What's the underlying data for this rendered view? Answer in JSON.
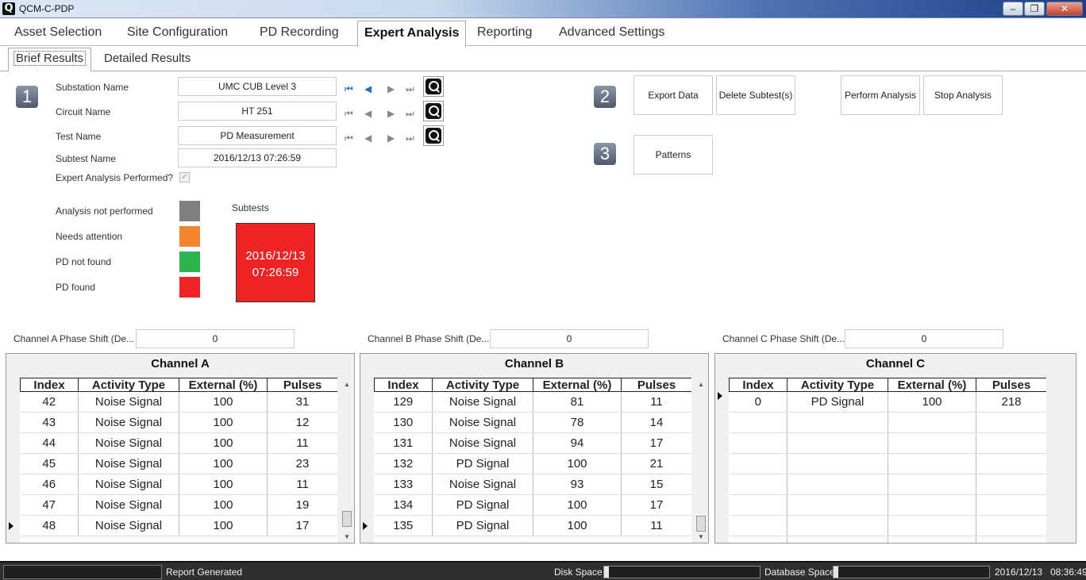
{
  "window": {
    "title": "QCM-C-PDP",
    "minimize": "‒",
    "maximize": "❐",
    "close": "✕"
  },
  "main_tabs": [
    "Asset Selection",
    "Site Configuration",
    "PD Recording",
    "Expert Analysis",
    "Reporting",
    "Advanced Settings"
  ],
  "active_main_tab": "Expert Analysis",
  "sub_tabs": [
    "Brief Results",
    "Detailed Results"
  ],
  "steps": [
    "1",
    "2",
    "3"
  ],
  "form": {
    "substation_label": "Substation Name",
    "substation_value": "UMC CUB Level 3",
    "circuit_label": "Circuit Name",
    "circuit_value": "HT 251",
    "test_label": "Test Name",
    "test_value": "PD Measurement",
    "subtest_label": "Subtest Name",
    "subtest_value": "2016/12/13 07:26:59",
    "expert_label": "Expert Analysis Performed?",
    "expert_checked": "✓"
  },
  "buttons": {
    "export": "Export Data",
    "delete": "Delete Subtest(s)",
    "perform": "Perform Analysis",
    "stop": "Stop Analysis",
    "patterns": "Patterns"
  },
  "legend": [
    {
      "label": "Analysis not performed",
      "color": "#808080"
    },
    {
      "label": "Needs attention",
      "color": "#f28430"
    },
    {
      "label": "PD not found",
      "color": "#2db350"
    },
    {
      "label": "PD found",
      "color": "#ee2326"
    }
  ],
  "subtests": {
    "title": "Subtests",
    "date": "2016/12/13",
    "time": "07:26:59",
    "color": "#ee2326"
  },
  "phase_shift": {
    "a_label": "Channel A Phase Shift (De...",
    "a_value": "0",
    "b_label": "Channel B Phase Shift (De...",
    "b_value": "0",
    "c_label": "Channel C Phase Shift (De...",
    "c_value": "0"
  },
  "columns": [
    "Index",
    "Activity Type",
    "External (%)",
    "Pulses"
  ],
  "channels": {
    "a": {
      "title": "Channel A",
      "rows": [
        [
          "42",
          "Noise Signal",
          "100",
          "31"
        ],
        [
          "43",
          "Noise Signal",
          "100",
          "12"
        ],
        [
          "44",
          "Noise Signal",
          "100",
          "11"
        ],
        [
          "45",
          "Noise Signal",
          "100",
          "23"
        ],
        [
          "46",
          "Noise Signal",
          "100",
          "11"
        ],
        [
          "47",
          "Noise Signal",
          "100",
          "19"
        ],
        [
          "48",
          "Noise Signal",
          "100",
          "17"
        ]
      ]
    },
    "b": {
      "title": "Channel B",
      "rows": [
        [
          "129",
          "Noise Signal",
          "81",
          "11"
        ],
        [
          "130",
          "Noise Signal",
          "78",
          "14"
        ],
        [
          "131",
          "Noise Signal",
          "94",
          "17"
        ],
        [
          "132",
          "PD Signal",
          "100",
          "21"
        ],
        [
          "133",
          "Noise Signal",
          "93",
          "15"
        ],
        [
          "134",
          "PD Signal",
          "100",
          "17"
        ],
        [
          "135",
          "PD Signal",
          "100",
          "11"
        ]
      ]
    },
    "c": {
      "title": "Channel C",
      "rows": [
        [
          "0",
          "PD Signal",
          "100",
          "218"
        ]
      ]
    }
  },
  "status": {
    "report": "Report Generated",
    "disk": "Disk Space",
    "database": "Database Space",
    "disk_fraction": 0.03,
    "database_fraction": 0.03,
    "date": "2016/12/13",
    "time": "08:36:49"
  }
}
